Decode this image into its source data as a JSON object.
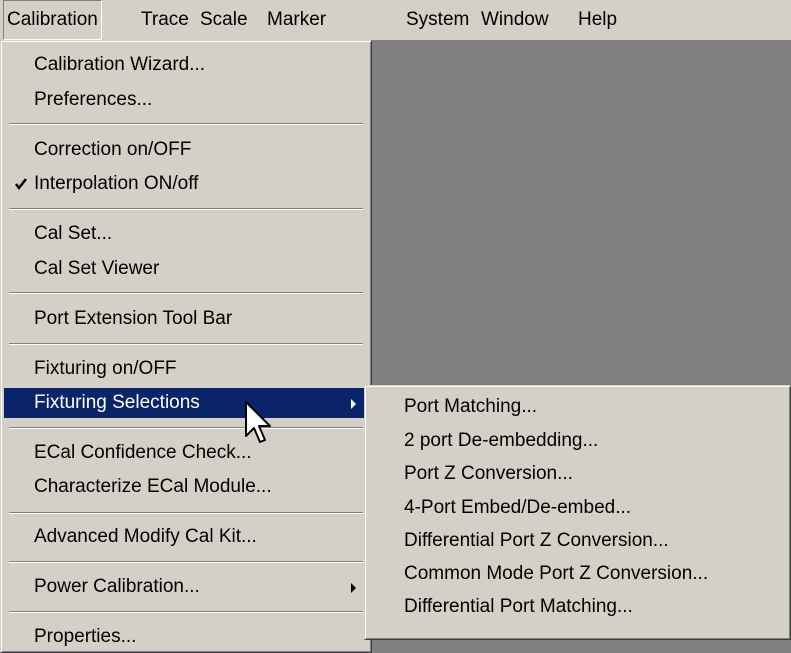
{
  "menubar": {
    "items": [
      "Calibration",
      "Trace",
      "Scale",
      "Marker",
      "System",
      "Window",
      "Help"
    ]
  },
  "calibration_menu": {
    "items": [
      "Calibration Wizard...",
      "Preferences...",
      "Correction on/OFF",
      "Interpolation ON/off",
      "Cal Set...",
      "Cal Set Viewer",
      "Port Extension Tool Bar",
      "Fixturing on/OFF",
      "Fixturing Selections",
      "ECal Confidence Check...",
      "Characterize ECal Module...",
      "Advanced Modify Cal Kit...",
      "Power Calibration...",
      "Properties..."
    ]
  },
  "fixturing_submenu": {
    "items": [
      "Port Matching...",
      "2 port De-embedding...",
      "Port Z Conversion...",
      "4-Port Embed/De-embed...",
      "Differential Port Z Conversion...",
      "Common Mode Port Z Conversion...",
      "Differential Port Matching..."
    ]
  },
  "colors": {
    "menu_bg": "#d4d0c8",
    "workspace_bg": "#808080",
    "highlight_bg": "#0a246a",
    "highlight_fg": "#ffffff"
  }
}
